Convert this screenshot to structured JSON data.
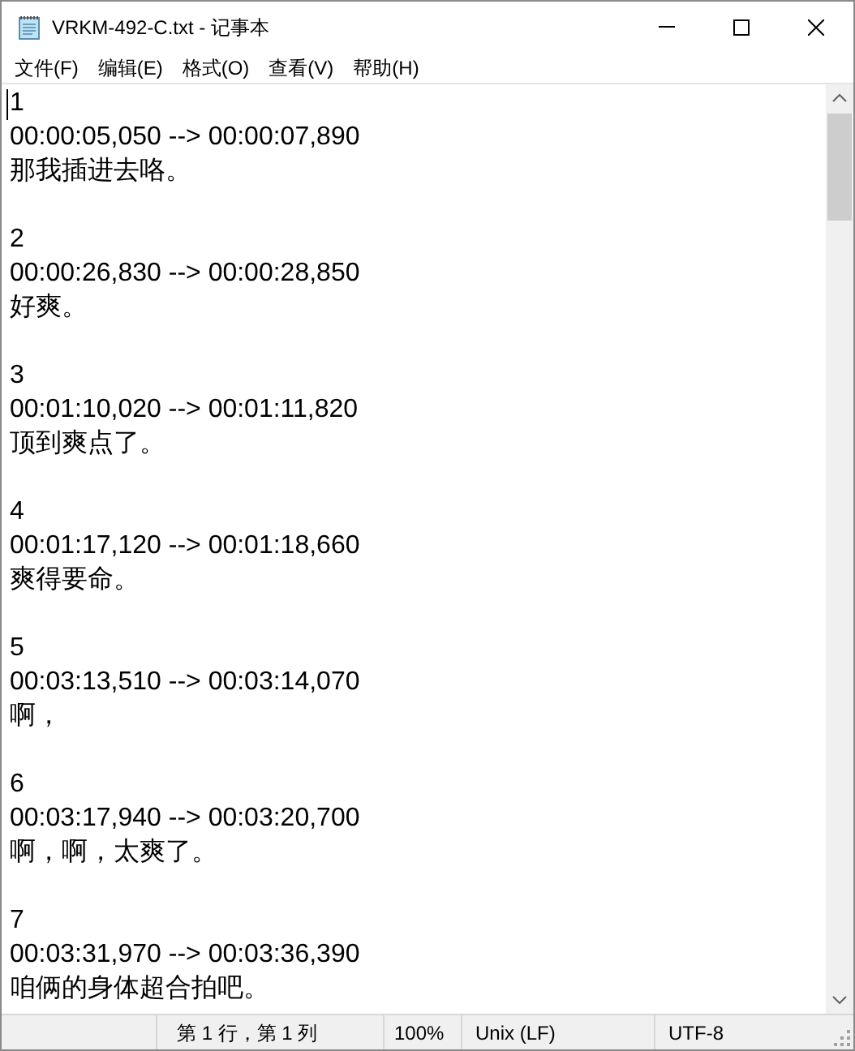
{
  "window": {
    "title": "VRKM-492-C.txt - 记事本"
  },
  "menu": [
    "文件(F)",
    "编辑(E)",
    "格式(O)",
    "查看(V)",
    "帮助(H)"
  ],
  "entries": [
    {
      "number": "1",
      "time": "00:00:05,050 --> 00:00:07,890",
      "text": "那我插进去咯。"
    },
    {
      "number": "2",
      "time": "00:00:26,830 --> 00:00:28,850",
      "text": "好爽。"
    },
    {
      "number": "3",
      "time": "00:01:10,020 --> 00:01:11,820",
      "text": "顶到爽点了。"
    },
    {
      "number": "4",
      "time": "00:01:17,120 --> 00:01:18,660",
      "text": "爽得要命。"
    },
    {
      "number": "5",
      "time": "00:03:13,510 --> 00:03:14,070",
      "text": "啊，"
    },
    {
      "number": "6",
      "time": "00:03:17,940 --> 00:03:20,700",
      "text": "啊，啊，太爽了。"
    },
    {
      "number": "7",
      "time": "00:03:31,970 --> 00:03:36,390",
      "text": "咱俩的身体超合拍吧。"
    }
  ],
  "status_bar": {
    "position": "第 1 行，第 1 列",
    "zoom": "100%",
    "line_ending": "Unix (LF)",
    "encoding": "UTF-8"
  }
}
